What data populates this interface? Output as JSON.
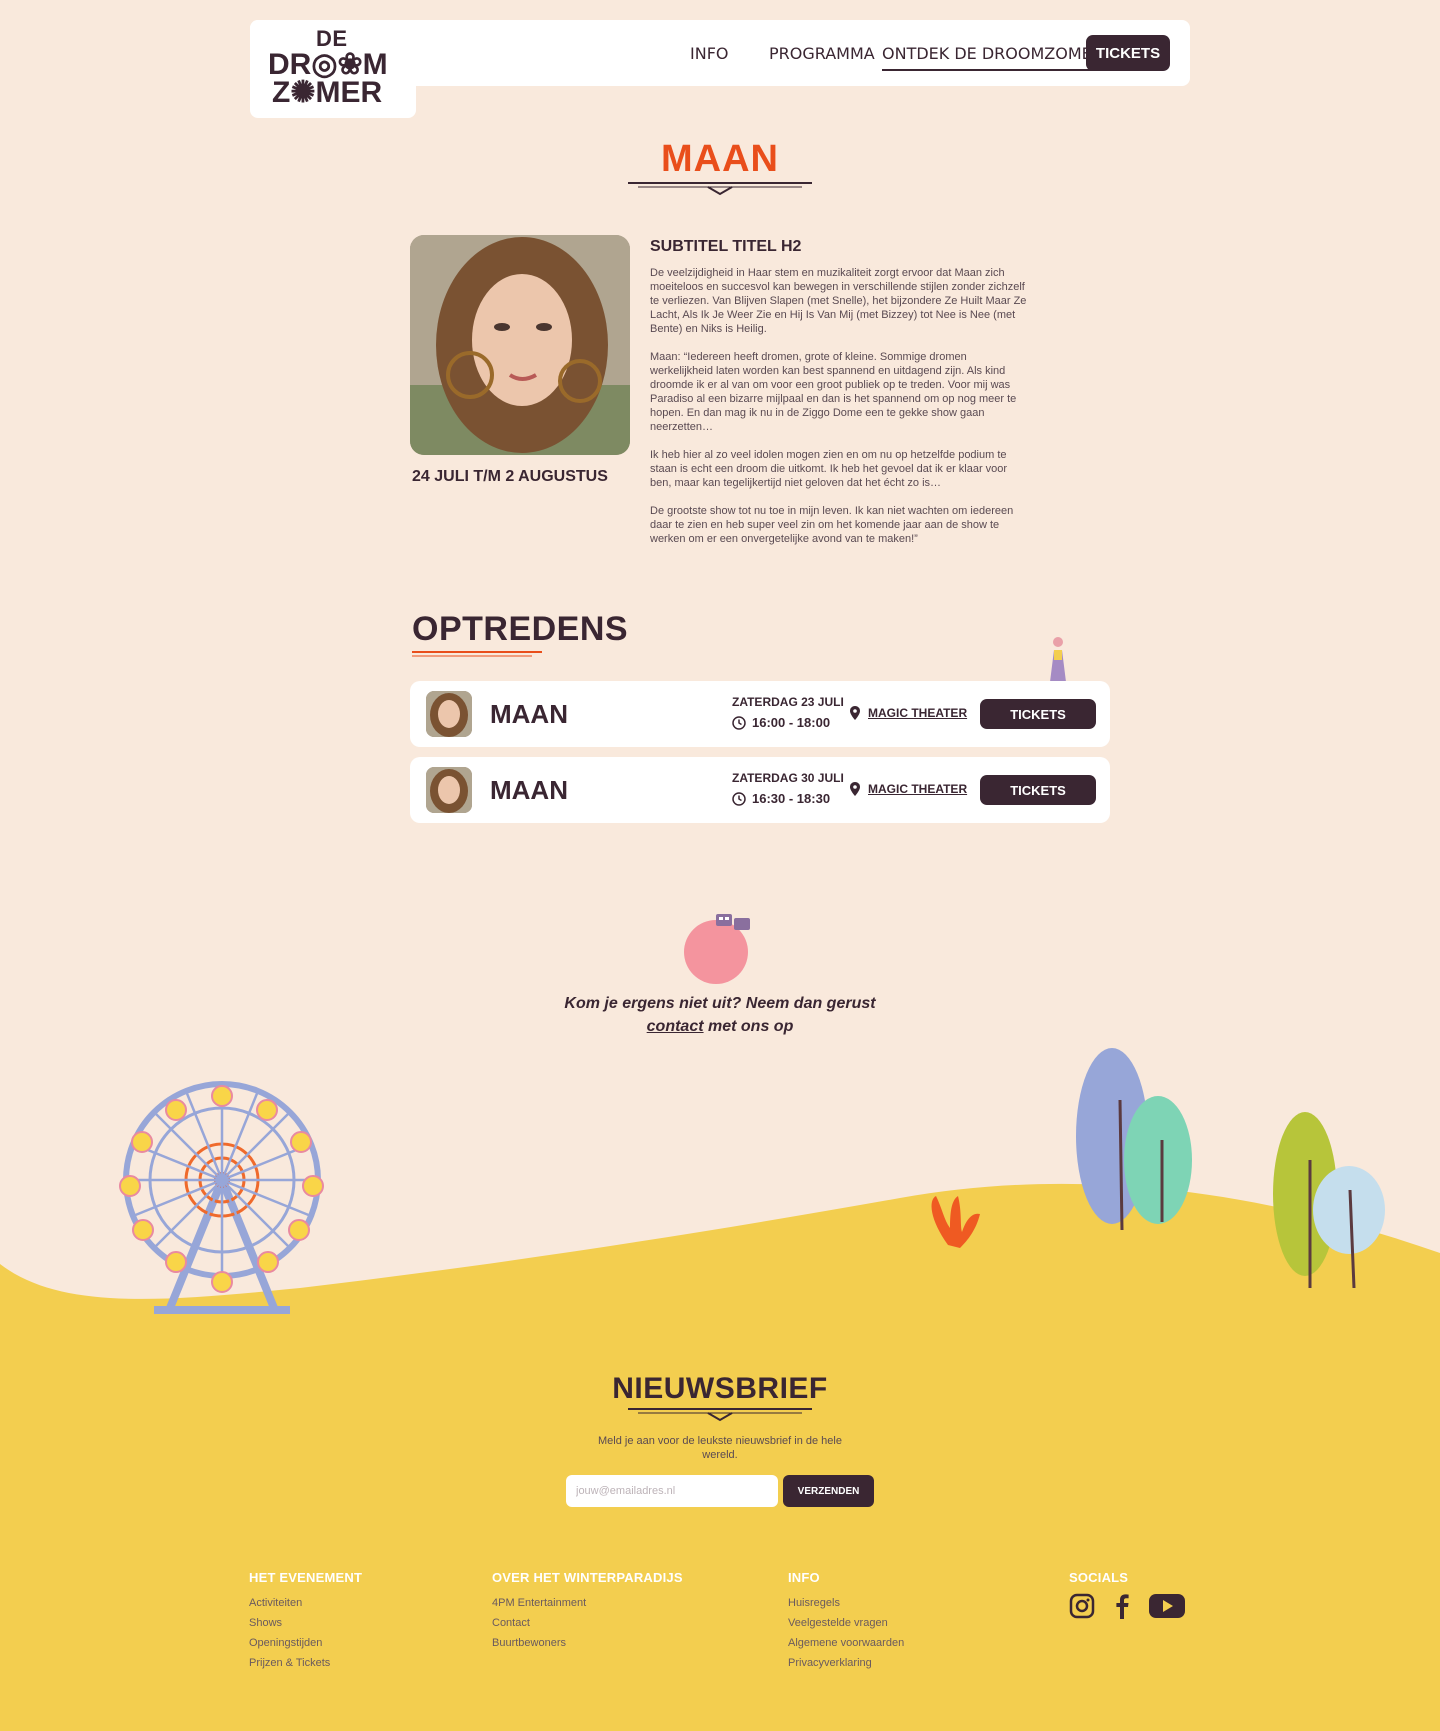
{
  "brand": {
    "logo_line1": "DE",
    "logo_line2": "DR◎❀M",
    "logo_line3": "Z✺MER"
  },
  "nav": {
    "links": [
      "INFO",
      "PROGRAMMA",
      "ONTDEK DE DROOMZOMER"
    ],
    "active_index": 2,
    "tickets_label": "TICKETS"
  },
  "page": {
    "title": "MAAN"
  },
  "artist": {
    "subtitle": "SUBTITEL TITEL H2",
    "dates": "24 JULI T/M 2 AUGUSTUS",
    "bio": [
      "De veelzijdigheid in Haar stem en muzikaliteit zorgt ervoor dat Maan zich moeiteloos en succesvol kan bewegen in verschillende stijlen zonder zichzelf te verliezen. Van Blijven Slapen (met Snelle), het bijzondere Ze Huilt Maar Ze Lacht, Als Ik Je Weer Zie en Hij Is Van Mij (met Bizzey) tot Nee is Nee (met Bente) en Niks is Heilig.",
      "Maan: “Iedereen heeft dromen, grote of kleine. Sommige dromen werkelijkheid laten worden kan best spannend en uitdagend zijn. Als kind droomde ik er al van om voor een groot publiek op te treden. Voor mij was Paradiso al een bizarre mijlpaal en dan is het spannend om op nog meer te hopen. En dan mag ik nu in de Ziggo Dome een te gekke show gaan neerzetten…",
      "Ik heb hier al zo veel idolen mogen zien en om nu op hetzelfde podium te staan is echt een droom die uitkomt. Ik heb het gevoel dat ik er klaar voor ben, maar kan tegelijkertijd niet geloven dat het écht zo is…",
      "De grootste show tot nu toe in mijn leven. Ik kan niet wachten om iedereen daar te zien en heb super veel zin om het komende jaar aan de show te werken om er een onvergetelijke avond van te maken!”"
    ]
  },
  "performances": {
    "heading": "OPTREDENS",
    "rows": [
      {
        "name": "MAAN",
        "date": "ZATERDAG 23 JULI",
        "time": "16:00 - 18:00",
        "location": "MAGIC THEATER",
        "tickets_label": "TICKETS"
      },
      {
        "name": "MAAN",
        "date": "ZATERDAG 30 JULI",
        "time": "16:30 - 18:30",
        "location": "MAGIC THEATER",
        "tickets_label": "TICKETS"
      }
    ]
  },
  "contact": {
    "before": "Kom je ergens niet uit? Neem dan gerust ",
    "link": "contact",
    "after": " met ons op"
  },
  "newsletter": {
    "title": "NIEUWSBRIEF",
    "description": "Meld je aan voor de leukste nieuwsbrief in de hele wereld.",
    "placeholder": "jouw@emailadres.nl",
    "submit_label": "VERZENDEN"
  },
  "footer": {
    "columns": [
      {
        "title": "HET EVENEMENT",
        "links": [
          "Activiteiten",
          "Shows",
          "Openingstijden",
          "Prijzen & Tickets"
        ]
      },
      {
        "title": "OVER HET WINTERPARADIJS",
        "links": [
          "4PM Entertainment",
          "Contact",
          "Buurtbewoners"
        ]
      },
      {
        "title": "INFO",
        "links": [
          "Huisregels",
          "Veelgestelde vragen",
          "Algemene voorwaarden",
          "Privacyverklaring"
        ]
      }
    ],
    "socials_title": "SOCIALS",
    "socials": [
      "instagram-icon",
      "facebook-icon",
      "youtube-icon"
    ]
  },
  "colors": {
    "background": "#f9e9dc",
    "accent_orange": "#e94e1b",
    "dark_plum": "#3a2632",
    "hill_yellow": "#f3ce4f"
  }
}
